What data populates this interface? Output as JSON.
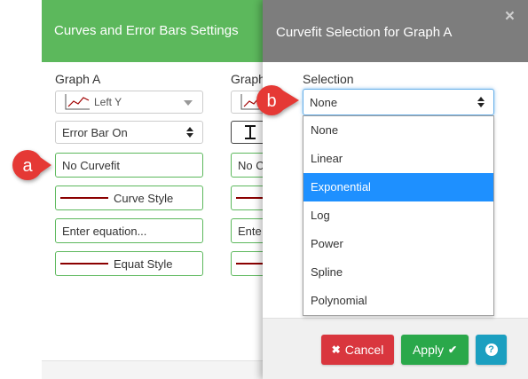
{
  "colors": {
    "settings_header": "#5cb85c",
    "dialog_header": "#7d7d7d",
    "input_border": "#5cb85c",
    "style_line": "#8b0000",
    "highlight": "#1e90ff",
    "cancel": "#d9363e",
    "apply": "#2aa84a",
    "help": "#1b9fc0",
    "marker": "#e53935"
  },
  "settings": {
    "title": "Curves and Error Bars Settings",
    "graph_a": {
      "label": "Graph A",
      "axis_select": "Left Y",
      "error_bar_select": "Error Bar On",
      "curvefit_button": "No Curvefit",
      "curve_style": "Curve Style",
      "equation_placeholder": "Enter equation...",
      "equat_style": "Equat Style"
    },
    "graph_b": {
      "label": "Graph",
      "curvefit_button": "No C",
      "equation_placeholder": "Ente"
    }
  },
  "dialog": {
    "title": "Curvefit Selection for Graph A",
    "close_icon": "×",
    "selection_label": "Selection",
    "selected_value": "None",
    "options": [
      "None",
      "Linear",
      "Exponential",
      "Log",
      "Power",
      "Spline",
      "Polynomial"
    ],
    "highlighted_index": 2,
    "cancel_glyph": "✖",
    "cancel_label": "Cancel",
    "apply_label": "Apply",
    "apply_glyph": "✔",
    "help_label": "?"
  },
  "annotations": {
    "a": "a",
    "b": "b"
  },
  "icons": {
    "axis_select": "line-chart-icon",
    "select_caret": "caret-down-icon",
    "select_arrows": "sort-arrows-icon",
    "error_bar": "error-bar-icon",
    "close": "close-icon",
    "cancel": "times-icon",
    "apply": "check-icon",
    "help": "question-circle-icon"
  }
}
